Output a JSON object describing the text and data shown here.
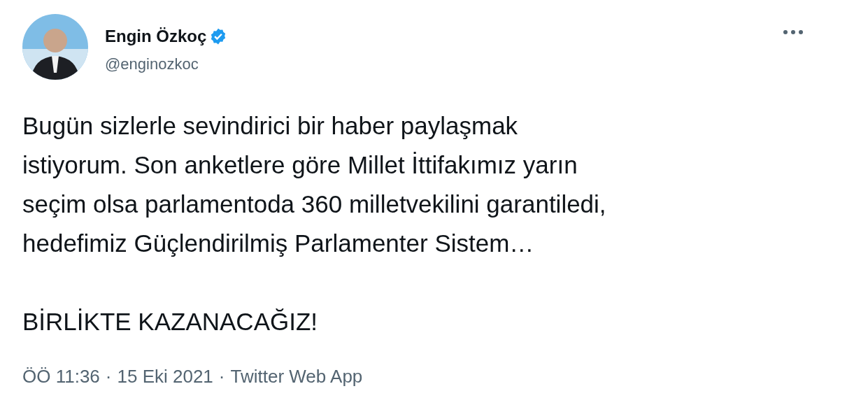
{
  "author": {
    "name": "Engin Özkoç",
    "verified": true,
    "handle": "@enginozkoc"
  },
  "tweet": {
    "paragraphs": [
      {
        "lines": [
          "Bugün sizlerle sevindirici bir haber paylaşmak",
          "istiyorum. Son anketlere göre Millet İttifakımız yarın",
          "seçim olsa parlamentoda 360 milletvekilini garantiledi,",
          "hedefimiz Güçlendirilmiş Parlamenter Sistem…"
        ]
      },
      {
        "lines": [
          "BİRLİKTE KAZANACAĞIZ!"
        ]
      }
    ]
  },
  "footer": [
    {
      "kind": "time",
      "text": "ÖÖ 11:36"
    },
    {
      "kind": "separator",
      "text": "·"
    },
    {
      "kind": "date",
      "text": "15 Eki 2021"
    },
    {
      "kind": "separator",
      "text": "·"
    },
    {
      "kind": "link",
      "text": "Twitter Web App"
    }
  ]
}
